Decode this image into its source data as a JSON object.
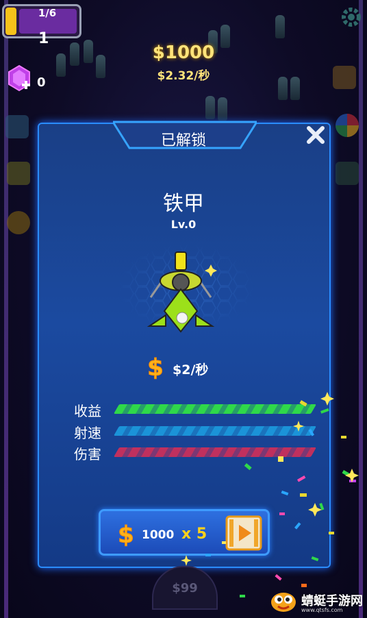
{
  "hud": {
    "level_progress": "1/6",
    "level_number": "1",
    "money": "$1000",
    "money_rate": "$2.32/秒",
    "gem_count": "0"
  },
  "panel": {
    "title": "已解锁",
    "item_name": "铁甲",
    "item_level": "Lv.0",
    "income": "$2/秒",
    "stats": [
      {
        "label": "收益",
        "value": 1.0,
        "color": "#2fd84a"
      },
      {
        "label": "射速",
        "value": 1.0,
        "color": "#1b93d8"
      },
      {
        "label": "伤害",
        "value": 1.0,
        "color": "#c0305e"
      }
    ]
  },
  "buy_button": {
    "cost": "1000",
    "multiplier": "x 5"
  },
  "bottom_button": {
    "price": "$99"
  },
  "watermark": {
    "text": "蜻蜓手游网",
    "url": "www.qtsfs.com"
  },
  "colors": {
    "panel_bg": "#1b4aa0",
    "panel_border": "#2a8cff",
    "accent_gold": "#ffd21a",
    "level_fill": "#f6c21a",
    "level_bg": "#6a2ca0"
  }
}
